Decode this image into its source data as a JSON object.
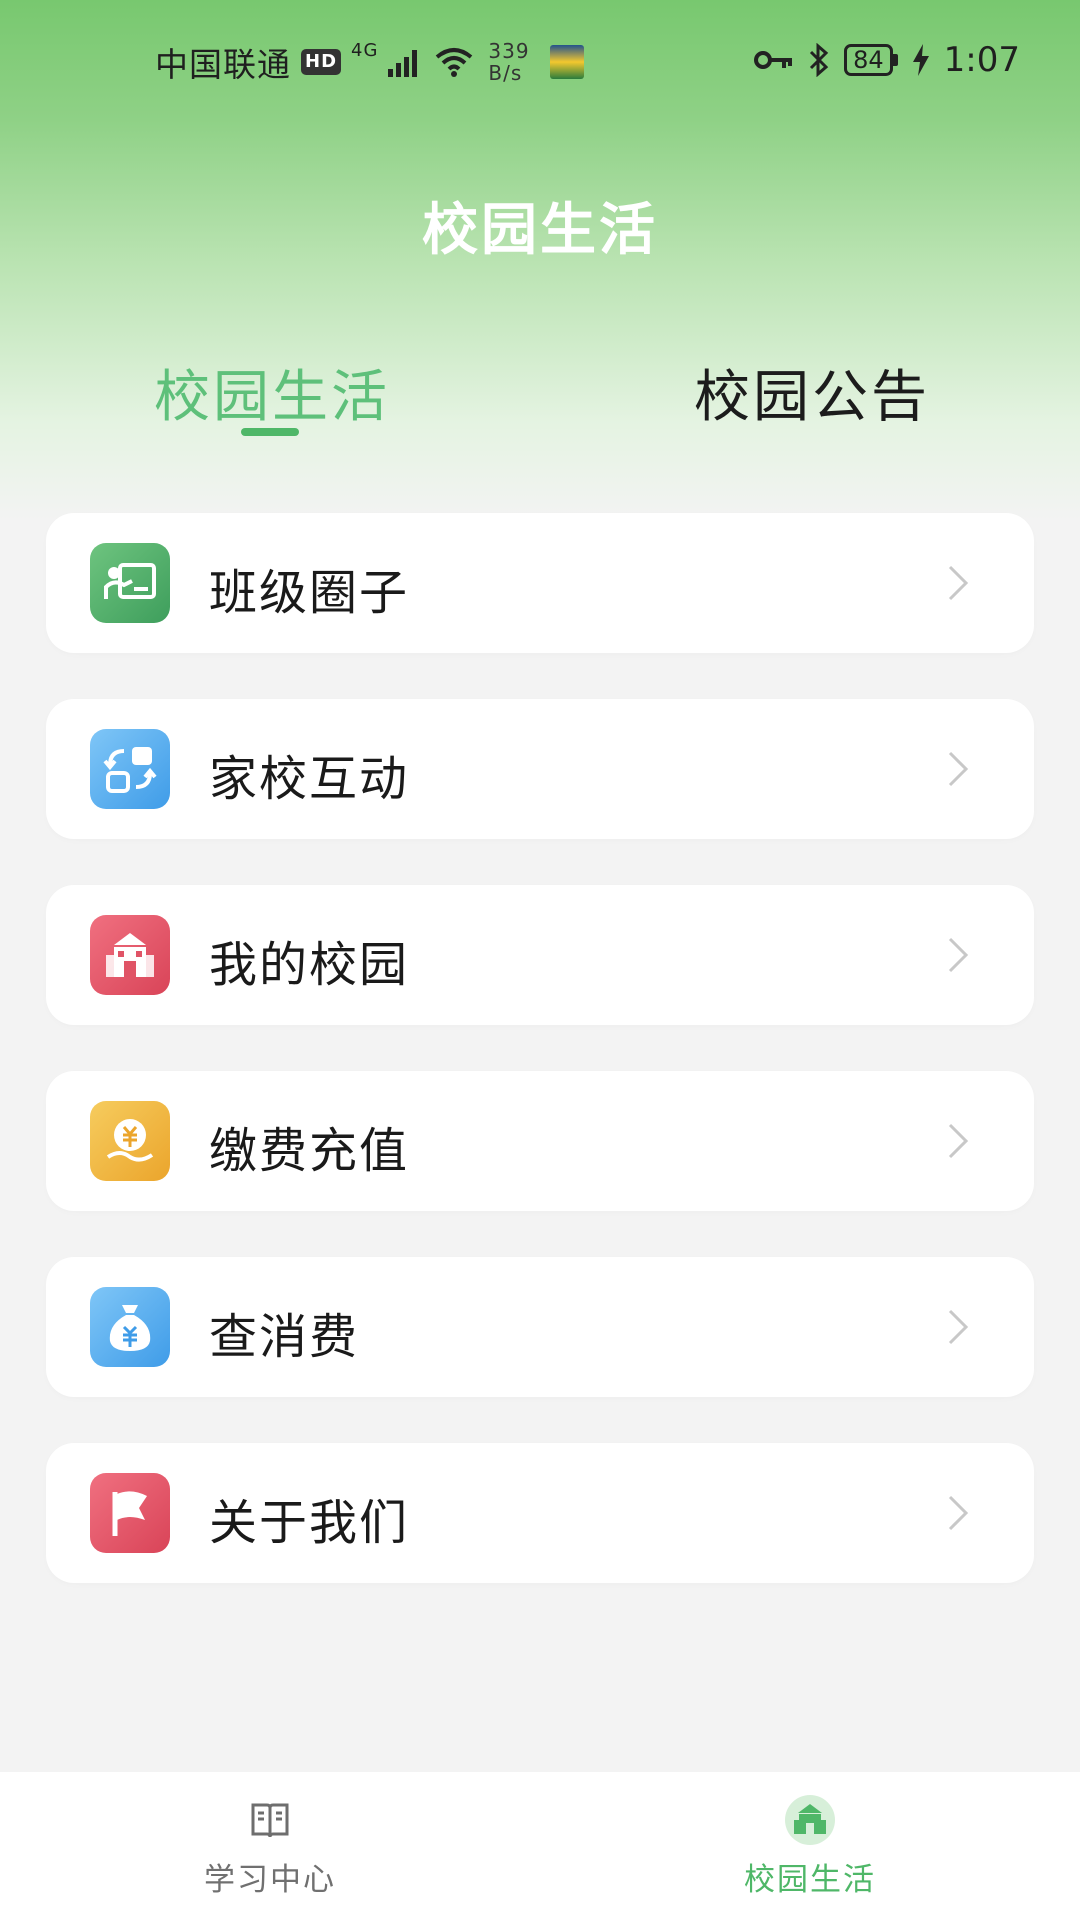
{
  "status_bar": {
    "carrier": "中国联通",
    "hd_badge": "HD",
    "network": "4G",
    "speed_value": "339",
    "speed_unit": "B/s",
    "battery": "84",
    "time": "1:07"
  },
  "header": {
    "title": "校园生活"
  },
  "tabs": [
    {
      "label": "校园生活",
      "active": true
    },
    {
      "label": "校园公告",
      "active": false
    }
  ],
  "menu": [
    {
      "label": "班级圈子",
      "icon": "classroom-icon",
      "color": "#4fb06a"
    },
    {
      "label": "家校互动",
      "icon": "interaction-icon",
      "color": "#4aa8f0"
    },
    {
      "label": "我的校园",
      "icon": "school-building-icon",
      "color": "#e8586a"
    },
    {
      "label": "缴费充值",
      "icon": "payment-icon",
      "color": "#f0b43a"
    },
    {
      "label": "查消费",
      "icon": "money-bag-icon",
      "color": "#4aa8f0"
    },
    {
      "label": "关于我们",
      "icon": "flag-icon",
      "color": "#e8586a"
    }
  ],
  "bottom_nav": [
    {
      "label": "学习中心",
      "icon": "book-icon",
      "active": false
    },
    {
      "label": "校园生活",
      "icon": "campus-icon",
      "active": true
    }
  ],
  "colors": {
    "accent": "#4fb768",
    "header_green": "#78c86f",
    "background": "#f3f3f3"
  }
}
